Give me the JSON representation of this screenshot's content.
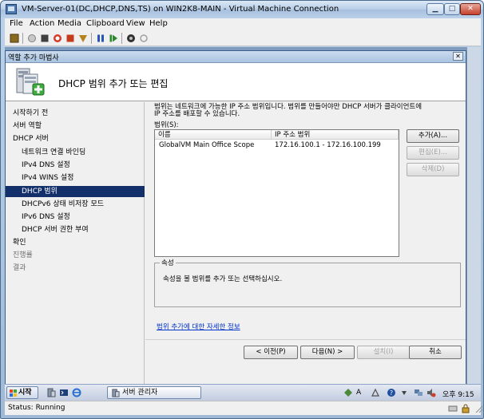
{
  "vm": {
    "title": "VM-Server-01(DC,DHCP,DNS,TS) on WIN2K8-MAIN - Virtual Machine Connection",
    "menu": [
      "File",
      "Action",
      "Media",
      "Clipboard",
      "View",
      "Help"
    ],
    "status": "Status: Running"
  },
  "toolbar_icons": [
    "ctrl-alt-del-icon",
    "start-icon",
    "turn-off-icon",
    "shut-down-icon",
    "save-state-icon",
    "pause-icon",
    "reset-icon",
    "snapshot-icon",
    "revert-icon"
  ],
  "wizard": {
    "window_title": "역할 추가 마법사",
    "heading": "DHCP 범위 추가 또는 편집",
    "nav": [
      {
        "label": "시작하기 전",
        "level": 1,
        "state": "normal"
      },
      {
        "label": "서버 역할",
        "level": 1,
        "state": "normal"
      },
      {
        "label": "DHCP 서버",
        "level": 1,
        "state": "normal"
      },
      {
        "label": "네트워크 연결 바인딩",
        "level": 2,
        "state": "normal"
      },
      {
        "label": "IPv4 DNS 설정",
        "level": 2,
        "state": "normal"
      },
      {
        "label": "IPv4 WINS 설정",
        "level": 2,
        "state": "normal"
      },
      {
        "label": "DHCP 범위",
        "level": 2,
        "state": "selected"
      },
      {
        "label": "DHCPv6 상태 비저장 모드",
        "level": 2,
        "state": "normal"
      },
      {
        "label": "IPv6 DNS 설정",
        "level": 2,
        "state": "normal"
      },
      {
        "label": "DHCP 서버 권한 부여",
        "level": 2,
        "state": "normal"
      },
      {
        "label": "확인",
        "level": 1,
        "state": "normal"
      },
      {
        "label": "진행률",
        "level": 1,
        "state": "muted"
      },
      {
        "label": "결과",
        "level": 1,
        "state": "muted"
      }
    ],
    "description_line1": "범위는 네트워크에 가능한 IP 주소 범위입니다. 범위를 만들어야만 DHCP 서버가 클라이언트에",
    "description_line2": "IP 주소를 배포할 수 있습니다.",
    "scopes_label": "범위(S):",
    "columns": [
      "이름",
      "IP 주소 범위"
    ],
    "rows": [
      {
        "name": "GlobalVM Main Office Scope",
        "range": "172.16.100.1 - 172.16.100.199"
      }
    ],
    "buttons": {
      "add": "추가(A)...",
      "edit": "편집(E)...",
      "delete": "삭제(D)"
    },
    "properties_label": "속성",
    "properties_text": "속성을 볼 범위를 추가 또는 선택하십시오.",
    "more_info_link": "범위 추가에 대한 자세한 정보",
    "footer": {
      "previous": "< 이전(P)",
      "next": "다음(N) >",
      "install": "설치(I)",
      "cancel": "취소"
    }
  },
  "taskbar": {
    "start": "시작",
    "task": "서버 관리자",
    "ime_label": "A",
    "clock": "오후 9:15"
  }
}
